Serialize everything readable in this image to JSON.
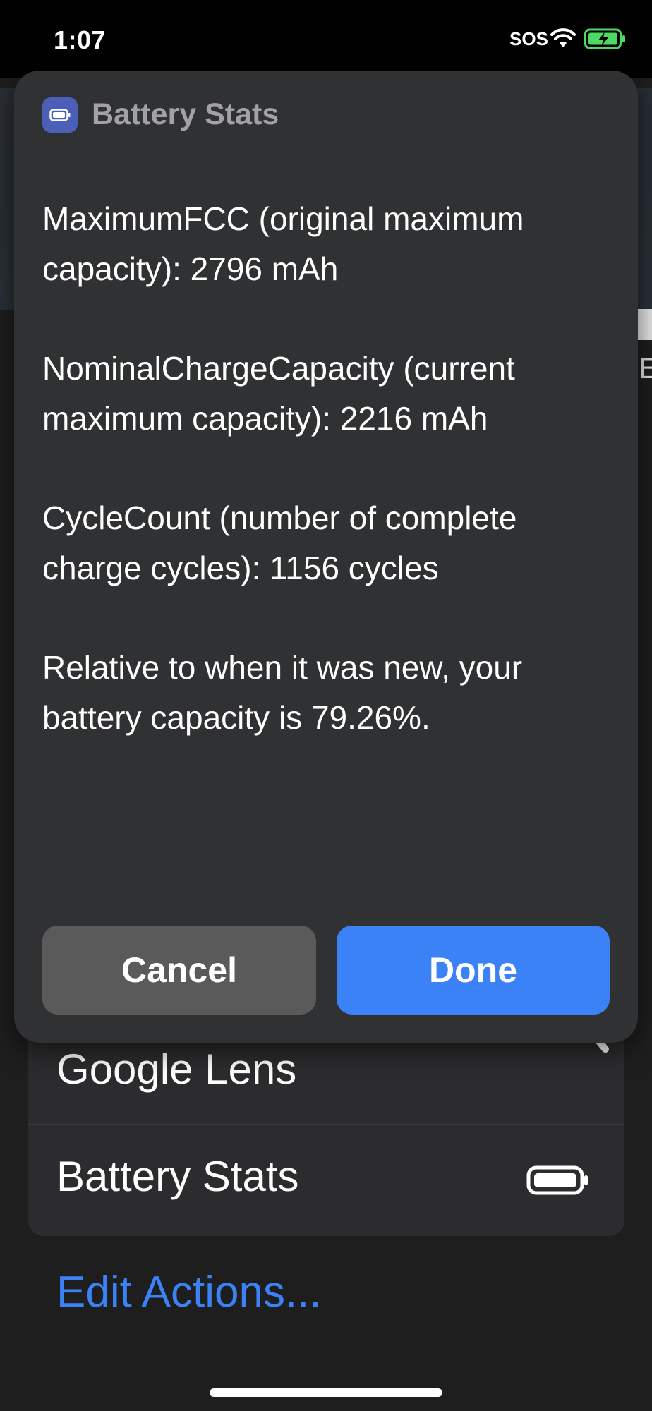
{
  "status_bar": {
    "time": "1:07",
    "sos": "SOS",
    "wifi_icon": "wifi-icon",
    "battery_icon": "battery-charging-icon",
    "battery_color": "#4cd964"
  },
  "background": {
    "edge_letter": "E"
  },
  "modal": {
    "app_icon": "battery-icon",
    "title": "Battery Stats",
    "paragraphs": [
      "MaximumFCC (original maximum capacity): 2796 mAh",
      "NominalChargeCapacity (current maximum capacity): 2216 mAh",
      "CycleCount (number of complete charge cycles): 1156 cycles",
      "Relative to when it was new, your battery capacity is 79.26%."
    ],
    "cancel_label": "Cancel",
    "done_label": "Done"
  },
  "action_list": {
    "items": [
      {
        "label": "Google Lens",
        "icon": "search-icon"
      },
      {
        "label": "Battery Stats",
        "icon": "battery-icon"
      }
    ],
    "edit_label": "Edit Actions..."
  },
  "colors": {
    "accent": "#3a82f6",
    "modal_bg": "#303132",
    "cancel_bg": "#5a5a5b"
  }
}
